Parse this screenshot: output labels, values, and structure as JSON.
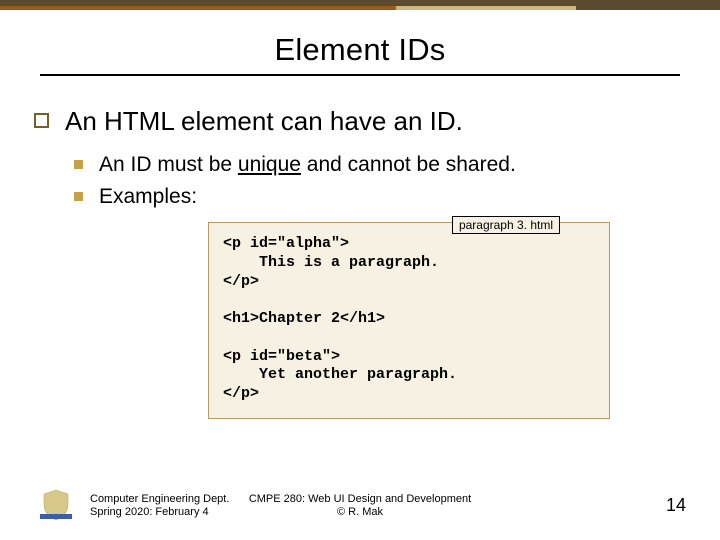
{
  "slide": {
    "title": "Element IDs",
    "bullet1_text": "An HTML element can have an ID.",
    "sub1_before": "An ID must be ",
    "sub1_underlined": "unique",
    "sub1_after": " and cannot be shared.",
    "sub2": "Examples:",
    "file_label": "paragraph 3. html",
    "code": "<p id=\"alpha\">\n    This is a paragraph.\n</p>\n\n<h1>Chapter 2</h1>\n\n<p id=\"beta\">\n    Yet another paragraph.\n</p>",
    "footer_left_line1": "Computer Engineering Dept.",
    "footer_left_line2": "Spring 2020: February 4",
    "footer_center_line1": "CMPE 280: Web UI Design and Development",
    "footer_center_line2": "© R. Mak",
    "page_number": "14"
  },
  "colors": {
    "accent_dark": "#5b4a2f",
    "accent_mid": "#985c1b",
    "accent_light": "#d1b57c",
    "bullet_gold": "#c7a14a",
    "codebox_bg": "#f6f1e3"
  }
}
